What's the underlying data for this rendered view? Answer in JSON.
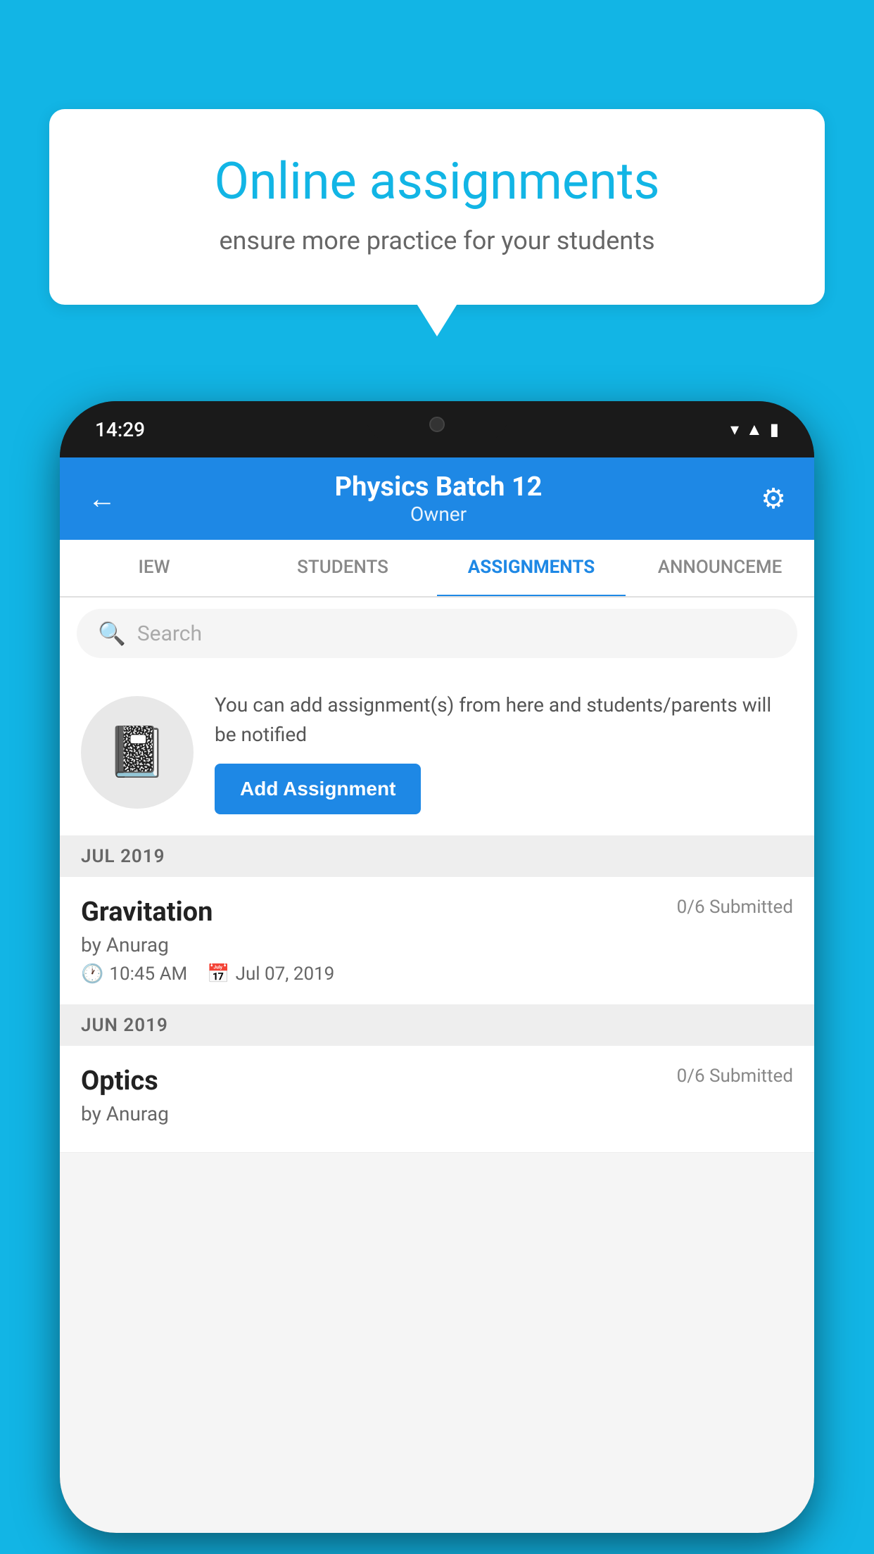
{
  "background_color": "#12B5E5",
  "speech_bubble": {
    "title": "Online assignments",
    "subtitle": "ensure more practice for your students"
  },
  "phone": {
    "status_bar": {
      "time": "14:29",
      "icons": [
        "wifi",
        "signal",
        "battery"
      ]
    },
    "header": {
      "title": "Physics Batch 12",
      "subtitle": "Owner",
      "back_label": "←",
      "settings_label": "⚙"
    },
    "tabs": [
      {
        "label": "IEW",
        "active": false
      },
      {
        "label": "STUDENTS",
        "active": false
      },
      {
        "label": "ASSIGNMENTS",
        "active": true
      },
      {
        "label": "ANNOUNCEME",
        "active": false
      }
    ],
    "search": {
      "placeholder": "Search"
    },
    "promo": {
      "text": "You can add assignment(s) from here and students/parents will be notified",
      "button_label": "Add Assignment"
    },
    "sections": [
      {
        "month": "JUL 2019",
        "assignments": [
          {
            "name": "Gravitation",
            "submitted": "0/6 Submitted",
            "author": "by Anurag",
            "time": "10:45 AM",
            "date": "Jul 07, 2019"
          }
        ]
      },
      {
        "month": "JUN 2019",
        "assignments": [
          {
            "name": "Optics",
            "submitted": "0/6 Submitted",
            "author": "by Anurag",
            "time": "",
            "date": ""
          }
        ]
      }
    ]
  }
}
